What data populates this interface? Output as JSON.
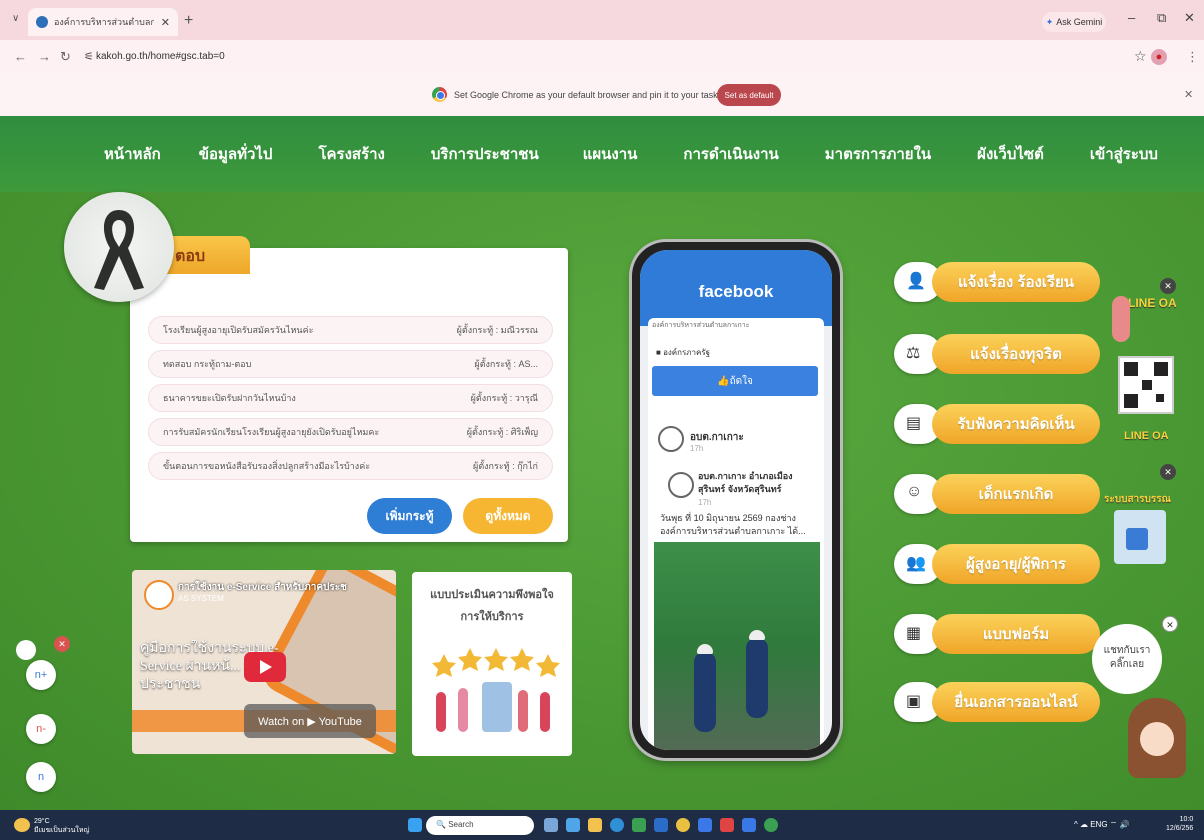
{
  "browser": {
    "tab_title": "องค์การบริหารส่วนตำบลกาเกาะ",
    "url": "kakoh.go.th/home#gsc.tab=0",
    "gemini": "Ask Gemini",
    "infobar_msg": "Set Google Chrome as your default browser and pin it to your taskbar",
    "set_default": "Set as default"
  },
  "nav": [
    "หน้าหลัก",
    "ข้อมูลทั่วไป",
    "โครงสร้าง",
    "บริการประชาชน",
    "แผนงาน",
    "การดำเนินงาน",
    "มาตรการภายใน",
    "ผังเว็บไซต์",
    "เข้าสู่ระบบ"
  ],
  "qa": {
    "heading": "ม ตอบ",
    "rows": [
      {
        "q": "โรงเรียนผู้สูงอายุเปิดรับสมัครวันไหนค่ะ",
        "by": "ผู้ตั้งกระทู้ : มณีวรรณ"
      },
      {
        "q": "ทดสอบ กระทู้ถาม-ตอบ",
        "by": "ผู้ตั้งกระทู้ : AS..."
      },
      {
        "q": "ธนาคารขยะเปิดรับฝากวันไหนบ้าง",
        "by": "ผู้ตั้งกระทู้ : วารุณี"
      },
      {
        "q": "การรับสมัครนักเรียนโรงเรียนผู้สูงอายุยังเปิดรับอยู่ไหมคะ",
        "by": "ผู้ตั้งกระทู้ : ศิริเพ็ญ"
      },
      {
        "q": "ขั้นตอนการขอหนังสือรับรองสิ่งปลูกสร้างมีอะไรบ้างค่ะ",
        "by": "ผู้ตั้งกระทู้ : กุ๊กไก่"
      }
    ],
    "add_btn": "เพิ่มกระทู้",
    "all_btn": "ดูทั้งหมด"
  },
  "video": {
    "title": "การใช้งาน e-Service สำหรับภาคประช",
    "channel": "AS SYSTEM",
    "big_text": "คู่มือการใช้งานระบบ e-Service ผ่านหน้... สำหรับประชาชน",
    "watch": "Watch on ▶ YouTube"
  },
  "survey": {
    "text": "แบบประเมินความพึงพอใจ การให้บริการ"
  },
  "facebook": {
    "brand": "facebook",
    "page_small": "องค์การบริหารส่วนตำบลกาเกาะ",
    "page_name": "องค์กรภาครัฐ",
    "like": "ถ้ดใจ",
    "post1_name": "อบต.กาเกาะ",
    "post1_time": "17h",
    "post2_name": "อบต.กาเกาะ อำเภอเมือง สุรินทร์ จังหวัดสุรินทร์",
    "post2_time": "17h",
    "post2_text": "วันพุธ ที่ 10 มิถุนายน 2569 กองช่าง องค์การบริหารส่วนตำบลกาเกาะ ได้..."
  },
  "services": [
    {
      "label": "แจ้งเรื่อง ร้องเรียน",
      "icon": "person-icon"
    },
    {
      "label": "แจ้งเรื่องทุจริต",
      "icon": "scales-icon"
    },
    {
      "label": "รับฟังความคิดเห็น",
      "icon": "board-icon"
    },
    {
      "label": "เด็กแรกเกิด",
      "icon": "baby-icon"
    },
    {
      "label": "ผู้สูงอายุ/ผู้พิการ",
      "icon": "people-icon"
    },
    {
      "label": "แบบฟอร์ม",
      "icon": "form-icon"
    },
    {
      "label": "ยื่นเอกสารออนไลน์",
      "icon": "document-icon"
    }
  ],
  "side": {
    "line_top": "LINE OA",
    "line_bottom": "LINE OA",
    "ebook": "ระบบสารบรรณ",
    "chat": "แชทกับเรา คลิ๊กเลย"
  },
  "fabs": [
    "n+",
    "n-",
    "n"
  ],
  "taskbar": {
    "temp": "29°C",
    "weather": "มีเมฆเป็นส่วนใหญ่",
    "search": "Search",
    "lang": "ENG",
    "time": "10:0",
    "date": "12/6/256"
  },
  "colors": {
    "green": "#4c9b35",
    "orange": "#f0a528",
    "blue": "#2e7ed6"
  }
}
